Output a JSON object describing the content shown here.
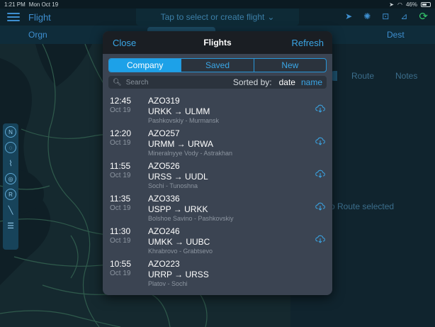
{
  "status": {
    "time": "1:21 PM",
    "date": "Mon Oct 19",
    "battery": "46%",
    "battery_level": 0.46
  },
  "app": {
    "title": "Flight",
    "select_prompt": "Tap to select or create flight"
  },
  "secbar": {
    "origin": "Orgn",
    "dest": "Dest"
  },
  "right_panel": {
    "tabs": [
      "Route",
      "Notes"
    ],
    "empty_text": "o Route selected"
  },
  "modal": {
    "close_label": "Close",
    "title": "Flights",
    "refresh_label": "Refresh",
    "segments": [
      {
        "label": "Company",
        "active": true
      },
      {
        "label": "Saved",
        "active": false
      },
      {
        "label": "New",
        "active": false
      }
    ],
    "search_placeholder": "Search",
    "sorted_by_label": "Sorted by:",
    "sort_date": "date",
    "sort_name": "name",
    "flights": [
      {
        "time": "12:45",
        "date": "Oct 19",
        "id": "AZO319",
        "route": "URKK → ULMM",
        "cities": "Pashkovskiy - Murmansk"
      },
      {
        "time": "12:20",
        "date": "Oct 19",
        "id": "AZO257",
        "route": "URMM → URWA",
        "cities": "Mineralnyye Vody - Astrakhan"
      },
      {
        "time": "11:55",
        "date": "Oct 19",
        "id": "AZO526",
        "route": "URSS → UUDL",
        "cities": "Sochi - Tunoshna"
      },
      {
        "time": "11:35",
        "date": "Oct 19",
        "id": "AZO336",
        "route": "USPP → URKK",
        "cities": "Bolshoe Savino - Pashkovskiy"
      },
      {
        "time": "11:30",
        "date": "Oct 19",
        "id": "AZO246",
        "route": "UMKK → UUBC",
        "cities": "Khrabrovo - Grabtsevo"
      },
      {
        "time": "10:55",
        "date": "Oct 19",
        "id": "AZO223",
        "route": "URRP → URSS",
        "cities": "Platov - Sochi"
      }
    ]
  },
  "colors": {
    "accent": "#1da1e8",
    "sync": "#35c46a",
    "modal_bg": "#3b4452"
  }
}
